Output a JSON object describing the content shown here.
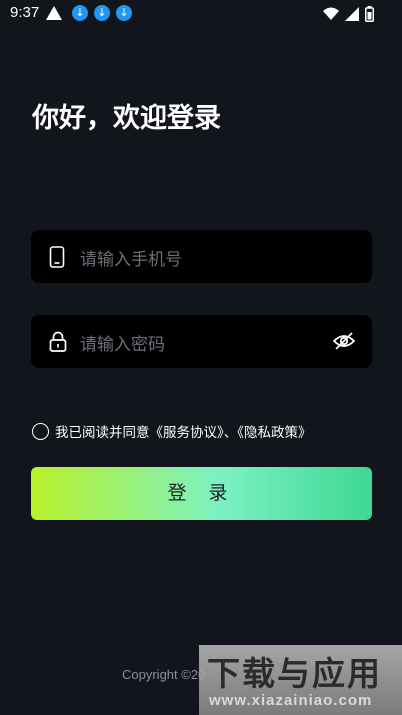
{
  "status_bar": {
    "time": "9:37",
    "icons": [
      "warning-icon",
      "download-icon",
      "download-icon",
      "download-icon",
      "wifi-icon",
      "signal-icon",
      "battery-icon"
    ]
  },
  "greeting": "你好，欢迎登录",
  "phone_input": {
    "placeholder": "请输入手机号",
    "icon": "phone-icon"
  },
  "password_input": {
    "placeholder": "请输入密码",
    "icon": "lock-icon",
    "toggle_icon": "eye-off-icon"
  },
  "agreement": {
    "text": "我已阅读并同意《服务协议》、《隐私政策》"
  },
  "login_button": {
    "label": "登 录"
  },
  "colors": {
    "background": "#12151b",
    "input_bg": "#000000",
    "gradient_start": "#b9f12a",
    "gradient_end": "#3ed893"
  },
  "footer": {
    "copyright": "Copyright ©20"
  },
  "watermark": {
    "title": "下载与应用",
    "url": "www.xiazainiao.com"
  }
}
